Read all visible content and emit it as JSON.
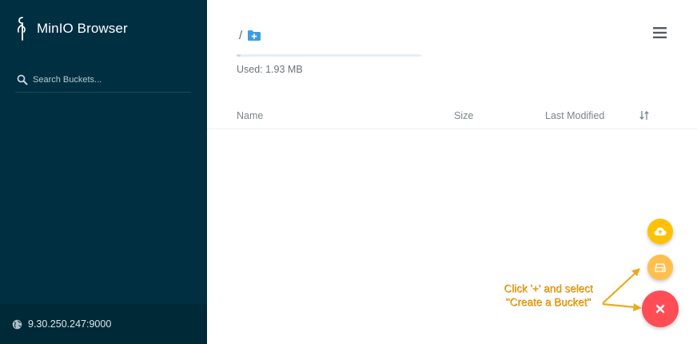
{
  "app": {
    "title": "MinIO Browser"
  },
  "sidebar": {
    "search": {
      "placeholder": "Search Buckets...",
      "value": ""
    },
    "host": "9.30.250.247:9000"
  },
  "main": {
    "breadcrumb": {
      "separator": "/"
    },
    "storage": {
      "used_label": "Used: 1.93 MB"
    },
    "table": {
      "columns": [
        "Name",
        "Size",
        "Last Modified"
      ],
      "rows": []
    }
  },
  "annotation": {
    "text": "Click '+' and select \"Create a Bucket\""
  },
  "icons": {
    "logo": "minio-logo",
    "search": "search-icon",
    "globe": "globe-icon",
    "folder_add": "folder-add-icon",
    "menu": "hamburger-menu-icon",
    "sort": "sort-icon",
    "upload": "cloud-upload-icon",
    "bucket": "bucket-icon",
    "close": "close-icon"
  },
  "colors": {
    "sidebar_bg": "#002f42",
    "accent_blue": "#46a8e0",
    "upload_fab": "#ffc107",
    "bucket_fab": "#ffbf4d",
    "close_fab": "#ff4d56",
    "annotation": "#f0a81a"
  }
}
